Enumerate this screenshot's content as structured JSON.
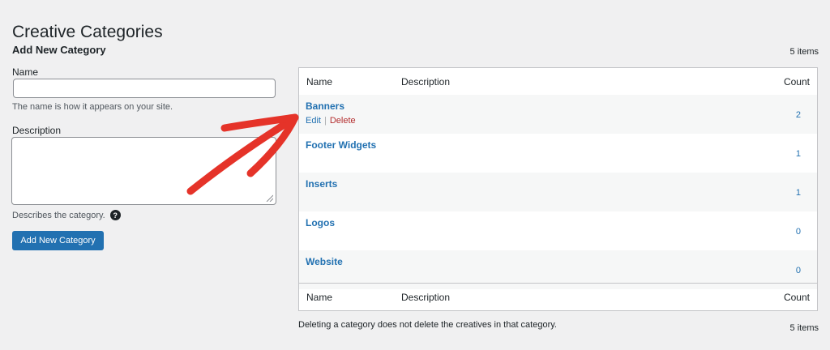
{
  "page": {
    "title": "Creative Categories"
  },
  "form": {
    "title": "Add New Category",
    "name_label": "Name",
    "name_value": "",
    "name_help": "The name is how it appears on your site.",
    "description_label": "Description",
    "description_value": "",
    "description_help": "Describes the category.",
    "help_icon_glyph": "?",
    "submit_label": "Add New Category"
  },
  "table": {
    "items_count": "5 items",
    "columns": {
      "name": "Name",
      "description": "Description",
      "count": "Count"
    },
    "row_actions": {
      "edit": "Edit",
      "separator": "|",
      "delete": "Delete"
    },
    "rows": [
      {
        "name": "Banners",
        "description": "",
        "count": "2"
      },
      {
        "name": "Footer Widgets",
        "description": "",
        "count": "1"
      },
      {
        "name": "Inserts",
        "description": "",
        "count": "1"
      },
      {
        "name": "Logos",
        "description": "",
        "count": "0"
      },
      {
        "name": "Website",
        "description": "",
        "count": "0"
      }
    ],
    "footnote": "Deleting a category does not delete the creatives in that category."
  },
  "colors": {
    "primary": "#2271b1",
    "delete": "#b32d2e",
    "annotation_arrow": "#e53329",
    "background": "#f0f0f1"
  }
}
